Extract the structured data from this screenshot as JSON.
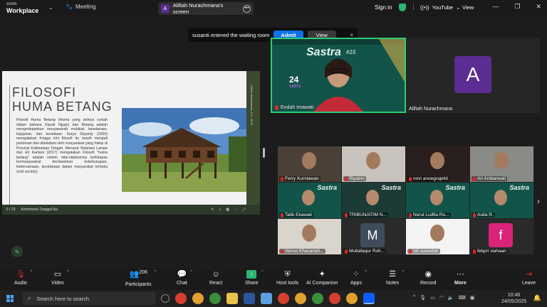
{
  "app": {
    "brand_top": "zoom",
    "brand_main": "Workplace"
  },
  "topbar": {
    "meeting_label": "Meeting",
    "share_avatar": "A",
    "share_label": "Alifiah Nurachmana's screen",
    "signin": "Sign in",
    "youtube": "YouTube",
    "view": "View"
  },
  "notification": {
    "text": "susanti entered the waiting room",
    "admit": "Admit",
    "view": "View",
    "close": "×"
  },
  "slide": {
    "title_line1": "FILOSOFI",
    "title_line2": "HUMA BETANG",
    "body": "Filosofi Huma Betang (Huma yang artinya rumah dalam bahasa Dayak Ngaju) dan Betang adalah mengedepankan musyawarah mufakat, kesetaraan, kejujuran, dan kesetiaan. Surya Sriyanty (2020) mengatakan hingga kini filosofi itu masih menjadi pedoman dan diteladani oleh masyarakat yang hidup di Provinsi Kalimantan Tengah. Menurut Yetwirani Lampe dan Eli Karliani (2017) mengatakan Filosofi \"huma betang\" adalah sistem nilai-nilai/norma kehidupan bermasyarakat berdasarkan kekeluargaan, kebersamaan, kesetaraan dalam masyarakat terbuka (civil society)",
    "side_text": "Alifiah Nurachmana, S.S., M.Pd",
    "page_indicator": "6 / 23",
    "footer_text": "Kehinmera Tunggal Ika"
  },
  "videos": {
    "endah": {
      "name": "Endah Imawati",
      "banner_title": "Sastra",
      "banner_num": "#15",
      "date": "24",
      "month": "SABTU"
    },
    "alifiah": {
      "name": "Alifiah Nurachmana",
      "avatar": "A"
    }
  },
  "gallery": [
    {
      "name": "Ferry Kurniawan",
      "bg": "#4a4038"
    },
    {
      "name": "Riyatno",
      "bg": "#c9c3bd"
    },
    {
      "name": "novi anoegrajekti",
      "bg": "#2a1f1f"
    },
    {
      "name": "Ari Ambarwati",
      "bg": "#8a8a86"
    },
    {
      "name": "Tatik Ekawati",
      "bg": "#12544a"
    },
    {
      "name": "TRIBUN/ATIM N...",
      "bg": "#1d3b36"
    },
    {
      "name": "Nurul Ludfia Ro...",
      "bg": "#12544a"
    },
    {
      "name": "Aulia R.",
      "bg": "#12544a"
    },
    {
      "name": "Venus Khasanah...",
      "bg": "#d9d4cc"
    },
    {
      "name": "Muttafaqur Roh...",
      "bg": "#2a2a2a",
      "avatar": "M",
      "avatar_bg": "#3f4c5c"
    },
    {
      "name": "siti suwadah",
      "bg": "#f4f4f4"
    },
    {
      "name": "febpri siahaan",
      "bg": "#2a2a2a",
      "avatar": "f",
      "avatar_bg": "#d9247a"
    }
  ],
  "gallery_banner": "Sastra",
  "toolbar": {
    "audio": "Audio",
    "video": "Video",
    "participants": "Participants",
    "participants_count": "206",
    "chat": "Chat",
    "react": "React",
    "share": "Share",
    "host_tools": "Host tools",
    "ai_companion": "AI Companion",
    "apps": "Apps",
    "notes": "Notes",
    "record": "Record",
    "more": "More",
    "leave": "Leave"
  },
  "taskbar": {
    "search_placeholder": "Search here to search",
    "time": "10:46",
    "date": "24/05/2025"
  },
  "colors": {
    "accent": "#0e72ed",
    "admit": "#0e72ed",
    "leave": "#e02828",
    "active_speaker": "#2ecc71",
    "avatar_purple": "#5b2c91"
  }
}
